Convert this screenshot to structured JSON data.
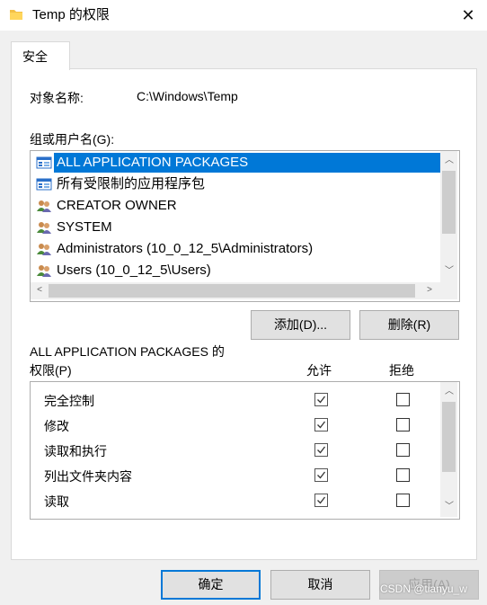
{
  "window": {
    "title": "Temp 的权限",
    "close_glyph": "✕"
  },
  "tabs": [
    {
      "label": "安全"
    }
  ],
  "object": {
    "label": "对象名称:",
    "value": "C:\\Windows\\Temp"
  },
  "group_list": {
    "label": "组或用户名(G):",
    "items": [
      {
        "label": "ALL APPLICATION PACKAGES",
        "icon": "app-packages-icon",
        "selected": true
      },
      {
        "label": "所有受限制的应用程序包",
        "icon": "app-packages-icon",
        "selected": false
      },
      {
        "label": "CREATOR OWNER",
        "icon": "users-icon",
        "selected": false
      },
      {
        "label": "SYSTEM",
        "icon": "users-icon",
        "selected": false
      },
      {
        "label": "Administrators (10_0_12_5\\Administrators)",
        "icon": "users-icon",
        "selected": false
      },
      {
        "label": "Users (10_0_12_5\\Users)",
        "icon": "users-icon",
        "selected": false
      }
    ]
  },
  "buttons": {
    "add": "添加(D)...",
    "remove": "删除(R)",
    "ok": "确定",
    "cancel": "取消",
    "apply": "应用(A)"
  },
  "permissions": {
    "for_label": "ALL APPLICATION PACKAGES 的",
    "label": "权限(P)",
    "allow_header": "允许",
    "deny_header": "拒绝",
    "rows": [
      {
        "name": "完全控制",
        "allow": true,
        "deny": false
      },
      {
        "name": "修改",
        "allow": true,
        "deny": false
      },
      {
        "name": "读取和执行",
        "allow": true,
        "deny": false
      },
      {
        "name": "列出文件夹内容",
        "allow": true,
        "deny": false
      },
      {
        "name": "读取",
        "allow": true,
        "deny": false
      }
    ]
  },
  "watermark": "CSDN @tianyu_w",
  "colors": {
    "selection": "#0078d7",
    "folder": "#f3c046"
  }
}
